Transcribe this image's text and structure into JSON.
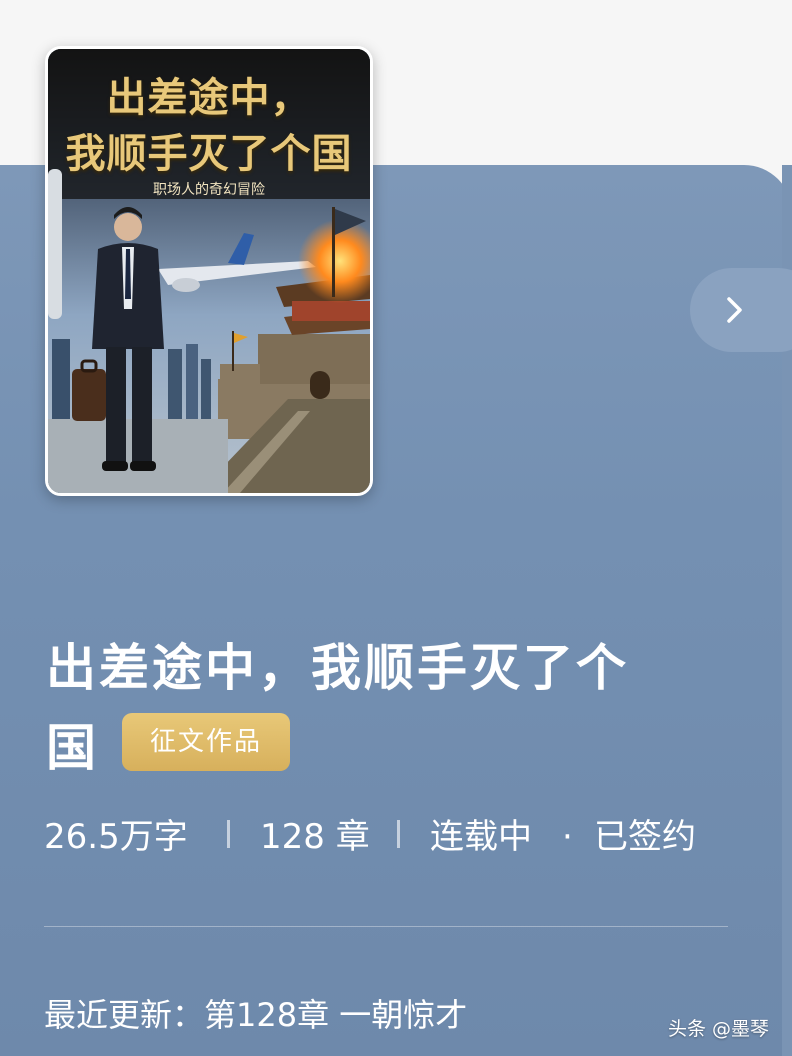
{
  "cover": {
    "title_line1": "出差途中，",
    "title_line2": "我顺手灭了个国",
    "subtitle": "职场人的奇幻冒险",
    "colors": {
      "title_gold": "#e8c87a",
      "sky": "#6f8fb5",
      "fire": "#ff8a1e"
    }
  },
  "book": {
    "title_line1": "出差途中，我顺手灭了个",
    "title_line2": "国",
    "badge": "征文作品",
    "word_count": "26.5万字",
    "chapters": "128 章",
    "status": "连载中",
    "dot": "·",
    "signed": "已签约",
    "latest_update": "最近更新：第128章 一朝惊才"
  },
  "nav": {
    "next_icon": "chevron-right-icon"
  },
  "watermark": "头条 @墨琴",
  "colors": {
    "panel": "#7490b2",
    "badge": "#ddb766",
    "page_bg": "#f6f6f6"
  }
}
